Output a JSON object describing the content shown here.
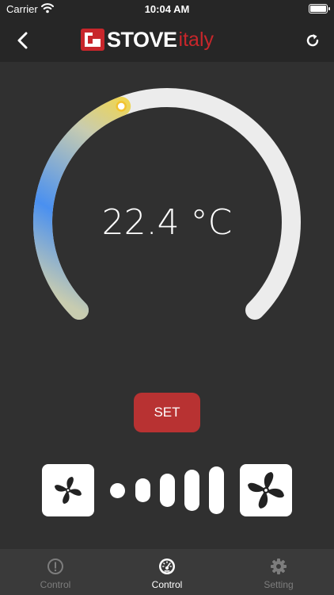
{
  "status_bar": {
    "carrier": "Carrier",
    "time": "10:04 AM",
    "battery_level": 1.0
  },
  "nav": {
    "brand_main": "STOVE",
    "brand_sub": "italy"
  },
  "thermostat": {
    "temperature": "22.4 °C",
    "set_point_fraction": 0.42,
    "colors": {
      "cold": "#4a90f0",
      "mid": "#c8ccb0",
      "warm": "#fcd833",
      "track": "#ececec"
    }
  },
  "set_button": {
    "label": "SET"
  },
  "fan": {
    "levels": 5,
    "accent": "#ffffff"
  },
  "tabs": [
    {
      "label": "Control",
      "icon": "info-icon",
      "active": false
    },
    {
      "label": "Control",
      "icon": "gauge-icon",
      "active": true
    },
    {
      "label": "Setting",
      "icon": "gear-icon",
      "active": false
    }
  ]
}
